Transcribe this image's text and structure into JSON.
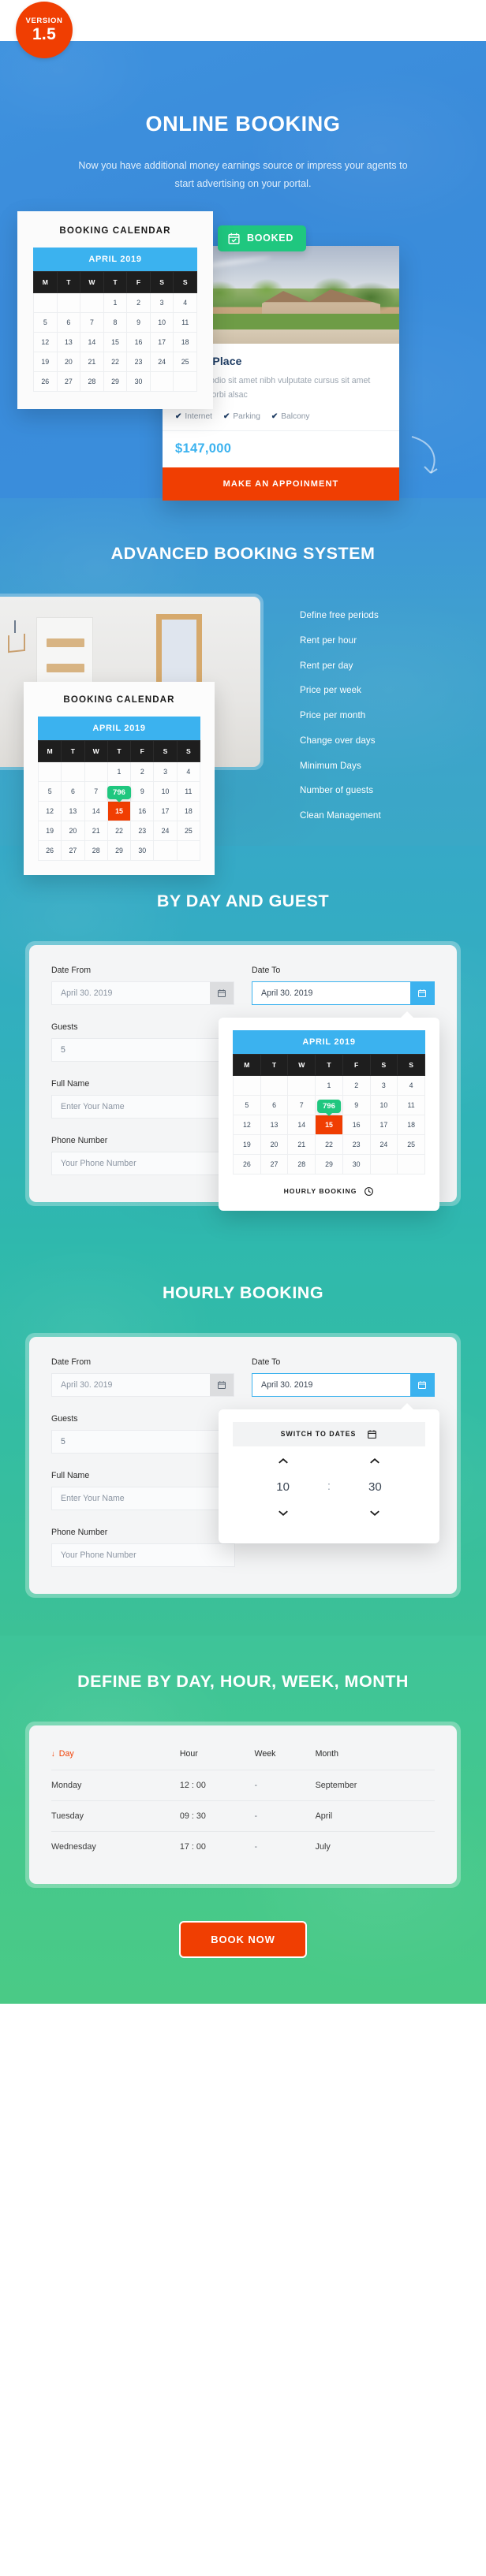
{
  "badge": {
    "word": "VERSION",
    "number": "1.5"
  },
  "hero": {
    "title": "ONLINE BOOKING",
    "subtitle": "Now you have additional money earnings source or impress your agents to start advertising on your portal.",
    "booked_label": "BOOKED",
    "booked_icon": "calendar-check-icon",
    "property": {
      "title": "Forest Place",
      "description": "Duis sed odio sit amet nibh vulputate cursus sit amet mauris. Morbi alsac",
      "features": [
        "Internet",
        "Parking",
        "Balcony"
      ],
      "price": "$147,000",
      "cta": "MAKE AN APPOINMENT"
    },
    "calendar": {
      "heading": "BOOKING CALENDAR",
      "month": "APRIL 2019",
      "weekdays": [
        "M",
        "T",
        "W",
        "T",
        "F",
        "S",
        "S"
      ],
      "weeks": [
        [
          "",
          "",
          "",
          "1",
          "2",
          "3",
          "4"
        ],
        [
          "5",
          "6",
          "7",
          "8",
          "9",
          "10",
          "11"
        ],
        [
          "12",
          "13",
          "14",
          "15",
          "16",
          "17",
          "18"
        ],
        [
          "19",
          "20",
          "21",
          "22",
          "23",
          "24",
          "25"
        ],
        [
          "26",
          "27",
          "28",
          "29",
          "30",
          "",
          ""
        ]
      ]
    }
  },
  "advanced": {
    "title": "ADVANCED BOOKING SYSTEM",
    "calendar": {
      "heading": "BOOKING CALENDAR",
      "month": "APRIL 2019",
      "weekdays": [
        "M",
        "T",
        "W",
        "T",
        "F",
        "S",
        "S"
      ],
      "weeks": [
        [
          "",
          "",
          "",
          "1",
          "2",
          "3",
          "4"
        ],
        [
          "5",
          "6",
          "7",
          "8",
          "9",
          "10",
          "11"
        ],
        [
          "12",
          "13",
          "14",
          "15",
          "16",
          "17",
          "18"
        ],
        [
          "19",
          "20",
          "21",
          "22",
          "23",
          "24",
          "25"
        ],
        [
          "26",
          "27",
          "28",
          "29",
          "30",
          "",
          ""
        ]
      ],
      "selected_day": "15",
      "price_bubble": "796"
    },
    "features": [
      "Define free periods",
      "Rent per hour",
      "Rent per day",
      "Price per week",
      "Price per month",
      "Change over days",
      "Minimum Days",
      "Number of guests",
      "Clean Management"
    ]
  },
  "byday": {
    "title": "BY DAY AND GUEST",
    "form": {
      "date_from_label": "Date From",
      "date_from_value": "April 30. 2019",
      "date_to_label": "Date To",
      "date_to_value": "April 30. 2019",
      "guests_label": "Guests",
      "guests_value": "5",
      "fullname_label": "Full Name",
      "fullname_placeholder": "Enter Your Name",
      "phone_label": "Phone Number",
      "phone_placeholder": "Your Phone Number",
      "calendar_icon": "calendar-icon"
    },
    "popover_calendar": {
      "month": "APRIL 2019",
      "weekdays": [
        "M",
        "T",
        "W",
        "T",
        "F",
        "S",
        "S"
      ],
      "weeks": [
        [
          "",
          "",
          "",
          "1",
          "2",
          "3",
          "4"
        ],
        [
          "5",
          "6",
          "7",
          "8",
          "9",
          "10",
          "11"
        ],
        [
          "12",
          "13",
          "14",
          "15",
          "16",
          "17",
          "18"
        ],
        [
          "19",
          "20",
          "21",
          "22",
          "23",
          "24",
          "25"
        ],
        [
          "26",
          "27",
          "28",
          "29",
          "30",
          "",
          ""
        ]
      ],
      "selected_day": "15",
      "price_bubble": "796",
      "footer_label": "HOURLY BOOKING",
      "footer_icon": "clock-icon"
    }
  },
  "hourly": {
    "title": "HOURLY BOOKING",
    "form": {
      "date_from_label": "Date From",
      "date_from_value": "April 30. 2019",
      "date_to_label": "Date To",
      "date_to_value": "April 30. 2019",
      "guests_label": "Guests",
      "guests_value": "5",
      "fullname_label": "Full Name",
      "fullname_placeholder": "Enter Your Name",
      "phone_label": "Phone Number",
      "phone_placeholder": "Your Phone Number"
    },
    "time_popover": {
      "switch_label": "SWITCH TO DATES",
      "switch_icon": "calendar-icon",
      "hours": "10",
      "separator": ":",
      "minutes": "30",
      "up_icon": "chevron-up-icon",
      "down_icon": "chevron-down-icon"
    }
  },
  "define": {
    "title": "DEFINE BY DAY, HOUR, WEEK, MONTH",
    "table": {
      "columns": [
        "Day",
        "Hour",
        "Week",
        "Month"
      ],
      "sorted_column": "Day",
      "sort_icon": "arrow-down-icon",
      "rows": [
        [
          "Monday",
          "12 : 00",
          "-",
          "September"
        ],
        [
          "Tuesday",
          "09 : 30",
          "-",
          "April"
        ],
        [
          "Wednesday",
          "17 : 00",
          "-",
          "July"
        ]
      ]
    },
    "cta": "BOOK NOW"
  },
  "colors": {
    "orange": "#f03e02",
    "blue": "#3bb2ef",
    "green": "#1fc77f",
    "dark": "#1e1e1e",
    "navy": "#1e3c63"
  }
}
